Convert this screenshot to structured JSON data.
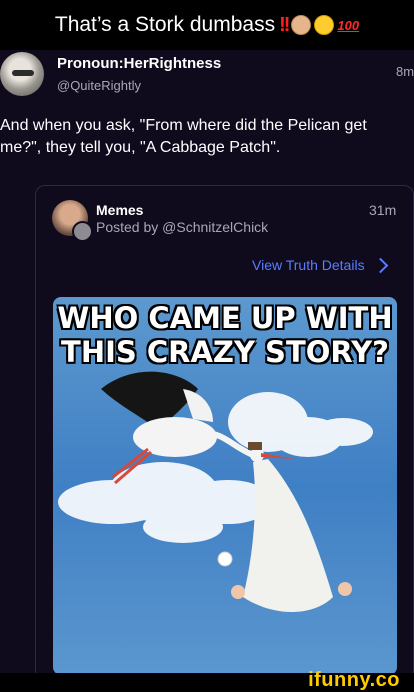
{
  "caption": {
    "text": "That’s a Stork dumbass",
    "bang": "!!",
    "hundred": "100"
  },
  "post": {
    "display_name": "Pronoun:HerRightness",
    "handle": "@QuiteRightly",
    "time": "8m",
    "text": "And when you ask, \"From where did the Pelican get me?\", they tell you, \"A Cabbage Patch\"."
  },
  "card": {
    "name": "Memes",
    "posted_by": "Posted by @SchnitzelChick",
    "time": "31m",
    "view_details": "View Truth Details",
    "meme_line1": "WHO CAME UP WITH",
    "meme_line2": "THIS CRAZY STORY?"
  },
  "watermark": "ifunny.co",
  "colors": {
    "background": "#0f0b1d",
    "accent_link": "#5b7cff",
    "watermark": "#ffcc00",
    "sky": "#3f7fc4"
  }
}
